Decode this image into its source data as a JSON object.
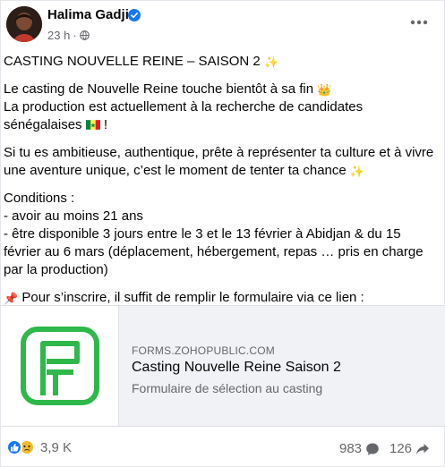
{
  "post": {
    "author": "Halima Gadji",
    "timestamp": "23 h",
    "separator": "·",
    "paragraphs": {
      "title": "CASTING NOUVELLE REINE – SAISON 2",
      "p1_line1": "Le casting de Nouvelle Reine touche bientôt à sa fin",
      "p1_line2": "La production est actuellement à la recherche de candidates",
      "p1_line3": "sénégalaises",
      "p1_line3_end": "!",
      "p2_line1": "Si tu es ambitieuse, authentique, prête à représenter ta culture et à vivre",
      "p2_line2": "une aventure unique, c’est le moment de tenter ta chance",
      "conditions_heading": "Conditions :",
      "condition1": "- avoir au moins 21 ans",
      "condition2_line1": "- être disponible 3 jours entre le 3 et le 13 février à Abidjan & du 15",
      "condition2_line2": "février au 6 mars (déplacement, hébergement, repas … pris en charge",
      "condition2_line3": "par la production)",
      "signup": "Pour s’inscrire, il suffit de remplir le formulaire via ce lien :"
    },
    "icons": {
      "sparkle": "✨",
      "crown": "👑",
      "pin": "📌"
    }
  },
  "link_preview": {
    "domain": "FORMS.ZOHOPUBLIC.COM",
    "title": "Casting Nouvelle Reine Saison 2",
    "description": "Formulaire de sélection au casting",
    "logo_color": "#2eb84a"
  },
  "footer": {
    "reaction_count": "3,9 K",
    "comment_count": "983",
    "share_count": "126"
  },
  "colors": {
    "accent": "#1877f2",
    "secondary_text": "#65676b",
    "link_bg": "#f0f2f5"
  }
}
